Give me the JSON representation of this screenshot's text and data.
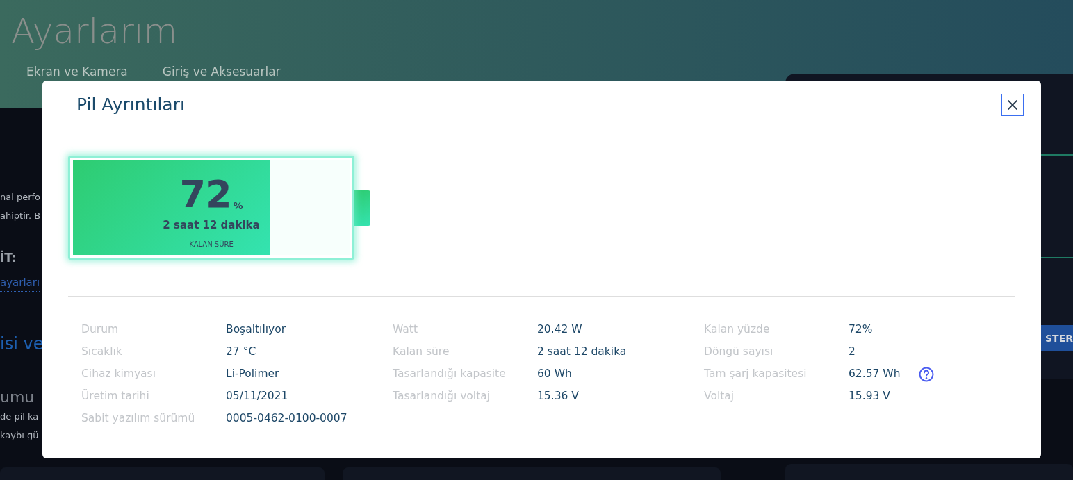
{
  "page": {
    "title": "Ayarlarım",
    "tabs": [
      {
        "label": "Ekran ve Kamera"
      },
      {
        "label": "Giriş ve Aksesuarlar"
      }
    ],
    "left_fragments": [
      {
        "kind": "text",
        "text": "nal perfo"
      },
      {
        "kind": "text",
        "text": "ahiptir. B"
      },
      {
        "kind": "label",
        "text": "İT:"
      },
      {
        "kind": "link",
        "text": "ayarları"
      },
      {
        "kind": "section",
        "text": "isi ve"
      },
      {
        "kind": "subtitle",
        "text": "umu"
      },
      {
        "kind": "text",
        "text": "de pil ka"
      },
      {
        "kind": "text",
        "text": "kaybı gü"
      }
    ],
    "right_button": "STER"
  },
  "dialog": {
    "title": "Pil Ayrıntıları",
    "battery": {
      "level": 0.71,
      "percent": "72",
      "unit": "%",
      "time": "2 saat 12 dakika",
      "caption": "KALAN SÜRE"
    },
    "details": [
      [
        {
          "label": "Durum",
          "value": "Boşaltılıyor"
        },
        {
          "label": "Sıcaklık",
          "value": "27 °C"
        },
        {
          "label": "Cihaz kimyası",
          "value": "Li-Polimer"
        },
        {
          "label": "Üretim tarihi",
          "value": "05/11/2021"
        },
        {
          "label": "Sabit yazılım sürümü",
          "value": "0005-0462-0100-0007"
        }
      ],
      [
        {
          "label": "Watt",
          "value": "20.42 W"
        },
        {
          "label": "Kalan süre",
          "value": "2 saat 12 dakika"
        },
        {
          "label": "Tasarlandığı kapasite",
          "value": "60 Wh"
        },
        {
          "label": "Tasarlandığı voltaj",
          "value": "15.36 V"
        }
      ],
      [
        {
          "label": "Kalan yüzde",
          "value": "72%"
        },
        {
          "label": "Döngü sayısı",
          "value": "2"
        },
        {
          "label": "Tam şarj kapasitesi",
          "value": "62.57 Wh",
          "help": true
        },
        {
          "label": "Voltaj",
          "value": "15.93 V"
        }
      ]
    ]
  }
}
